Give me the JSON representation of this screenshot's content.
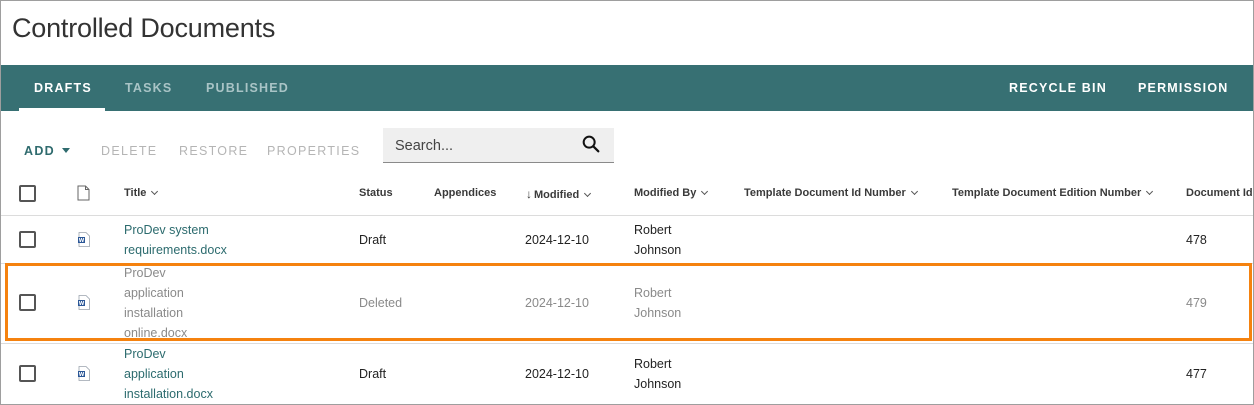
{
  "page": {
    "title": "Controlled Documents"
  },
  "tabs": {
    "drafts": "DRAFTS",
    "tasks": "TASKS",
    "published": "PUBLISHED",
    "recycle_bin": "RECYCLE BIN",
    "permission": "PERMISSION"
  },
  "toolbar": {
    "add": "ADD",
    "delete": "DELETE",
    "restore": "RESTORE",
    "properties": "PROPERTIES"
  },
  "search": {
    "placeholder": "Search..."
  },
  "columns": {
    "title": "Title",
    "status": "Status",
    "appendices": "Appendices",
    "modified": "Modified",
    "modified_by": "Modified By",
    "template_id": "Template Document Id Number",
    "template_edition": "Template Document Edition Number",
    "document_id": "Document Id"
  },
  "rows": [
    {
      "title_line1": "ProDev system",
      "title_line2": "requirements.docx",
      "status": "Draft",
      "modified": "2024-12-10",
      "modified_by_1": "Robert",
      "modified_by_2": "Johnson",
      "document_id": "478"
    },
    {
      "title_line1": "ProDev",
      "title_line2": "application",
      "title_line3": "installation",
      "title_line4": "online.docx",
      "status": "Deleted",
      "modified": "2024-12-10",
      "modified_by_1": "Robert",
      "modified_by_2": "Johnson",
      "document_id": "479"
    },
    {
      "title_line1": "ProDev",
      "title_line2": "application",
      "title_line3": "installation.docx",
      "status": "Draft",
      "modified": "2024-12-10",
      "modified_by_1": "Robert",
      "modified_by_2": "Johnson",
      "document_id": "477"
    }
  ],
  "colors": {
    "tabbar": "#377073",
    "link": "#2c6b6e",
    "highlight": "#f5820f"
  }
}
